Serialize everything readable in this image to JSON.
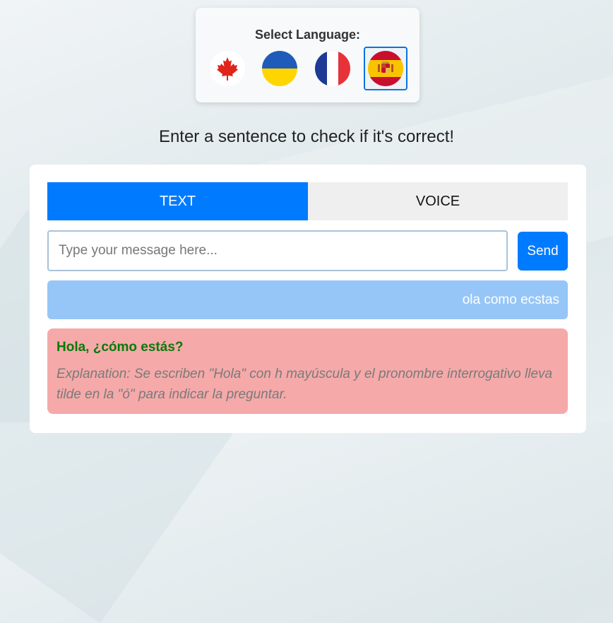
{
  "language_selector": {
    "title": "Select Language:",
    "flags": [
      {
        "name": "canada",
        "icon": "canada-flag-icon",
        "selected": false
      },
      {
        "name": "ukraine",
        "icon": "ukraine-flag-icon",
        "selected": false
      },
      {
        "name": "france",
        "icon": "france-flag-icon",
        "selected": false
      },
      {
        "name": "spain",
        "icon": "spain-flag-icon",
        "selected": true
      }
    ]
  },
  "headline": "Enter a sentence to check if it's correct!",
  "tabs": [
    {
      "label": "TEXT",
      "active": true
    },
    {
      "label": "VOICE",
      "active": false
    }
  ],
  "input": {
    "placeholder": "Type your message here...",
    "value": ""
  },
  "send_label": "Send",
  "messages": {
    "user": "ola como ecstas",
    "correction": {
      "corrected": "Hola, ¿cómo estás?",
      "explanation": "Explanation: Se escriben \"Hola\" con h mayúscula y el pronombre interrogativo lleva tilde en la \"ó\" para indicar la preguntar."
    }
  },
  "colors": {
    "accent": "#007bff",
    "user_bubble": "#96c6f8",
    "correction_bg": "#f5a9a9",
    "corrected_text": "#0a7a0a"
  }
}
